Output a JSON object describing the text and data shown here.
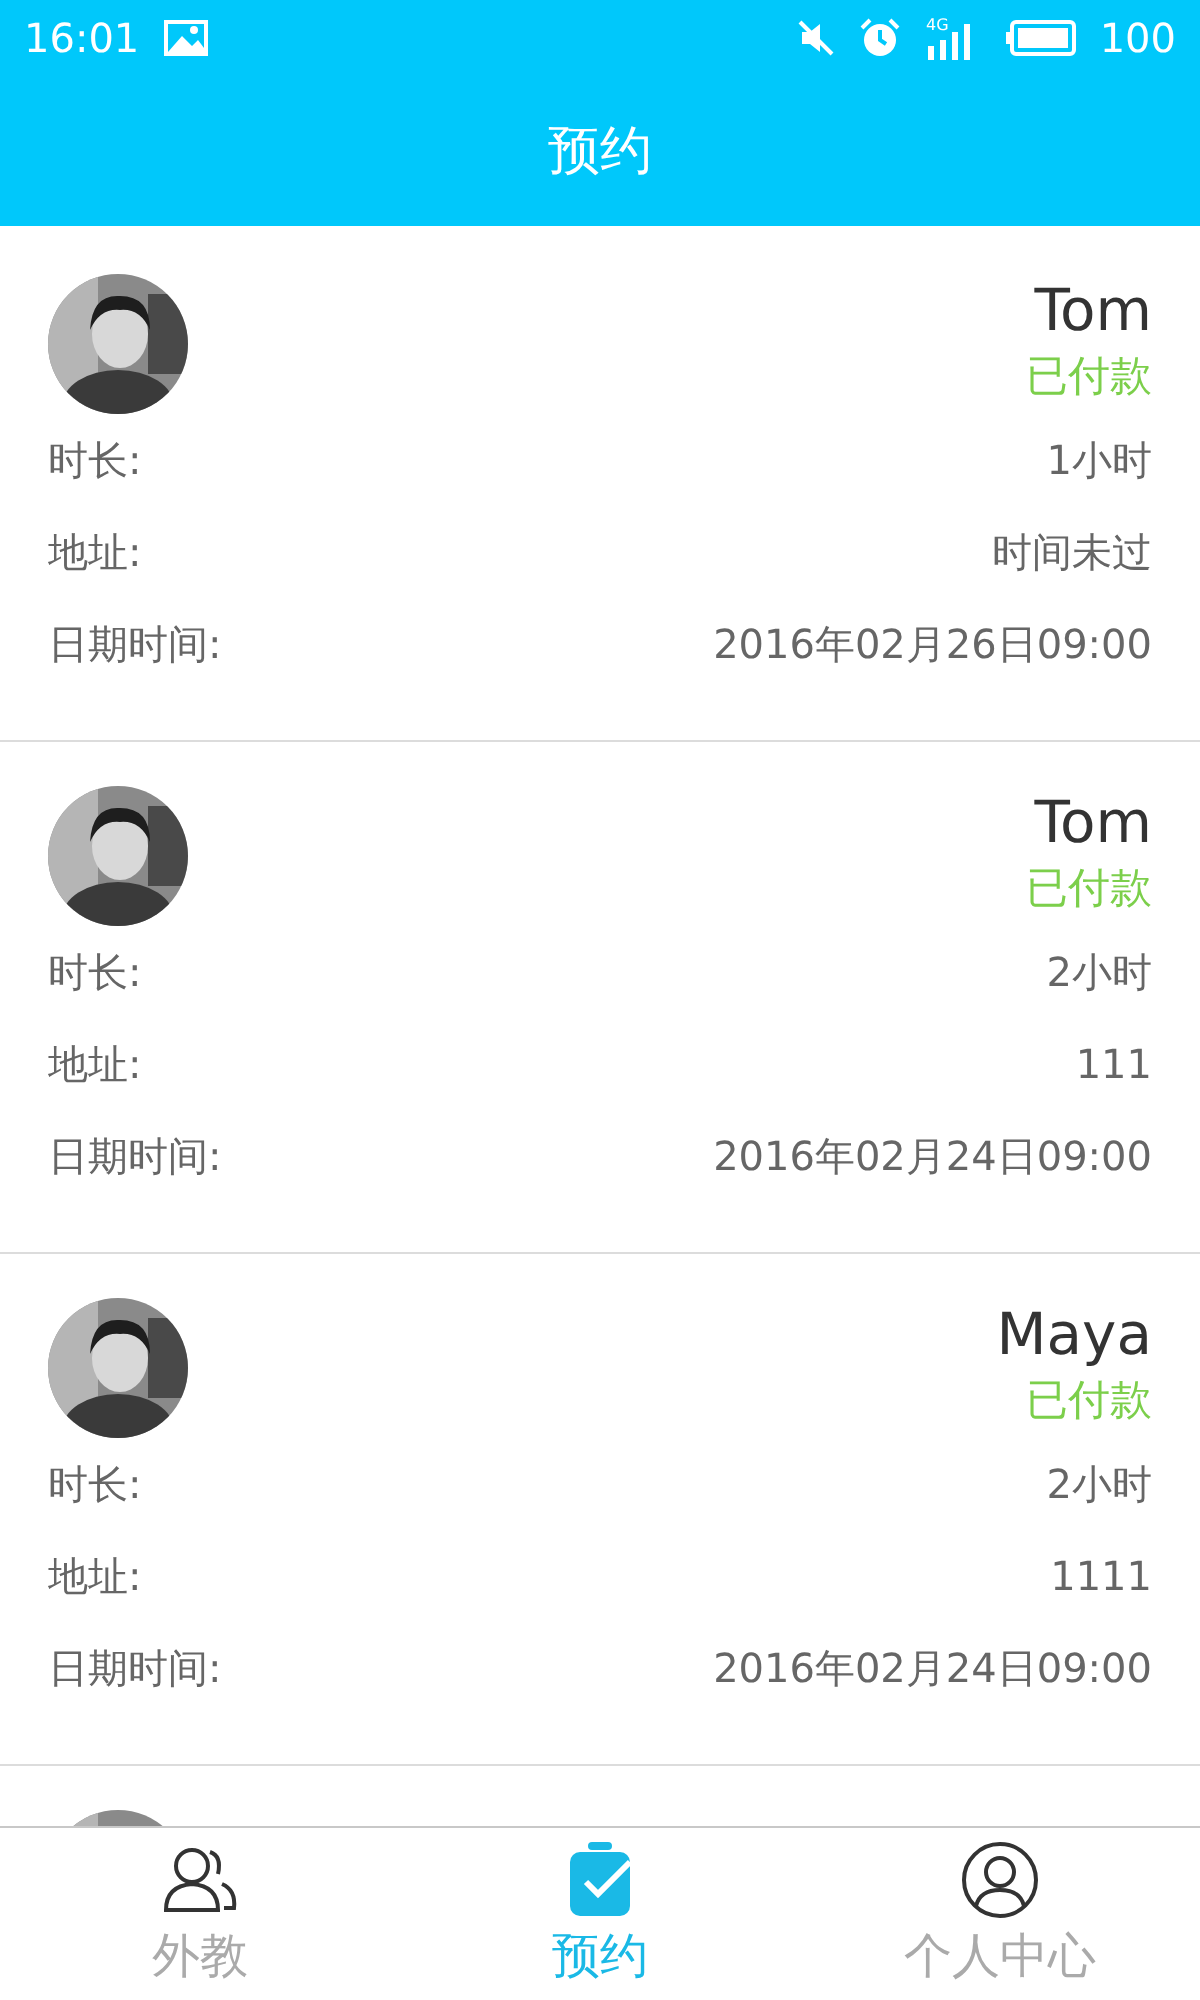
{
  "status_bar": {
    "time": "16:01",
    "network": "4G",
    "battery": "100"
  },
  "header": {
    "title": "预约"
  },
  "bookings": [
    {
      "avatar": {
        "kind": "picture"
      },
      "name": "Tom",
      "status": "已付款",
      "rows": [
        {
          "label": "时长:",
          "value": "1小时"
        },
        {
          "label": "地址:",
          "value": "时间未过"
        },
        {
          "label": "日期时间:",
          "value": "2016年02月26日09:00"
        }
      ]
    },
    {
      "avatar": {
        "kind": "picture"
      },
      "name": "Tom",
      "status": "已付款",
      "rows": [
        {
          "label": "时长:",
          "value": "2小时"
        },
        {
          "label": "地址:",
          "value": "111"
        },
        {
          "label": "日期时间:",
          "value": "2016年02月24日09:00"
        }
      ]
    },
    {
      "avatar": {
        "kind": "picture"
      },
      "name": "Maya",
      "status": "已付款",
      "rows": [
        {
          "label": "时长:",
          "value": "2小时"
        },
        {
          "label": "地址:",
          "value": "1111"
        },
        {
          "label": "日期时间:",
          "value": "2016年02月24日09:00"
        }
      ]
    },
    {
      "avatar": {
        "kind": "picture"
      }
    }
  ],
  "tab_bar": [
    {
      "label": "外教",
      "kind": "people",
      "selected": false
    },
    {
      "label": "预约",
      "kind": "clipboard",
      "selected": true
    },
    {
      "label": "个人中心",
      "kind": "person",
      "selected": false
    }
  ]
}
